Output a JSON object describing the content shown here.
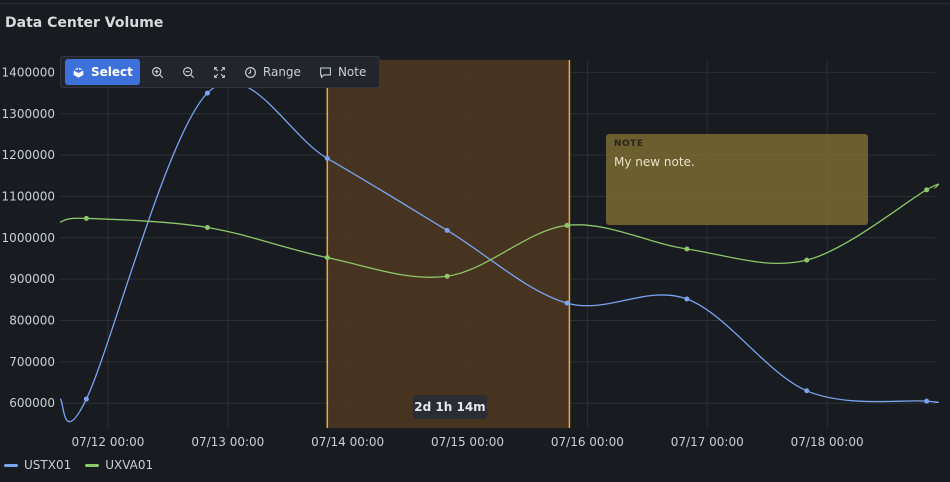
{
  "panel": {
    "title": "Data Center Volume"
  },
  "toolbar": {
    "select_label": "Select",
    "range_label": "Range",
    "note_label": "Note"
  },
  "note": {
    "heading": "NOTE",
    "text": "My new note."
  },
  "selection": {
    "duration_label": "2d 1h 14m"
  },
  "colors": {
    "ustx": "#7aa3f0",
    "uxva": "#8ec66a",
    "selection_fill": "#4a3621",
    "selection_border": "#f2a93b"
  },
  "chart_data": {
    "type": "line",
    "y_ticks": [
      "600000",
      "700000",
      "800000",
      "900000",
      "1000000",
      "1100000",
      "1200000",
      "1300000",
      "1400000"
    ],
    "x_ticks": [
      "07/12 00:00",
      "07/13 00:00",
      "07/14 00:00",
      "07/15 00:00",
      "07/16 00:00",
      "07/17 00:00",
      "07/18 00:00"
    ],
    "ylim": [
      540000,
      1430000
    ],
    "xlim_days": [
      11.6,
      18.9
    ],
    "series": [
      {
        "name": "USTX01",
        "color": "#7aa3f0",
        "points": [
          [
            11.6,
            610000
          ],
          [
            11.82,
            610000
          ],
          [
            12.83,
            1350000
          ],
          [
            13.83,
            1192000
          ],
          [
            14.83,
            1018000
          ],
          [
            15.83,
            842000
          ],
          [
            16.83,
            852000
          ],
          [
            17.83,
            630000
          ],
          [
            18.83,
            605000
          ],
          [
            18.9,
            602000
          ]
        ]
      },
      {
        "name": "UXVA01",
        "color": "#8ec66a",
        "points": [
          [
            11.6,
            1038000
          ],
          [
            11.82,
            1047000
          ],
          [
            12.83,
            1025000
          ],
          [
            13.83,
            952000
          ],
          [
            14.83,
            907000
          ],
          [
            15.83,
            1030000
          ],
          [
            16.83,
            973000
          ],
          [
            17.83,
            946000
          ],
          [
            18.83,
            1116000
          ],
          [
            18.9,
            1120000
          ]
        ]
      }
    ],
    "selection_days": [
      13.83,
      15.85
    ],
    "grid": true,
    "legend": "bottom-left"
  }
}
